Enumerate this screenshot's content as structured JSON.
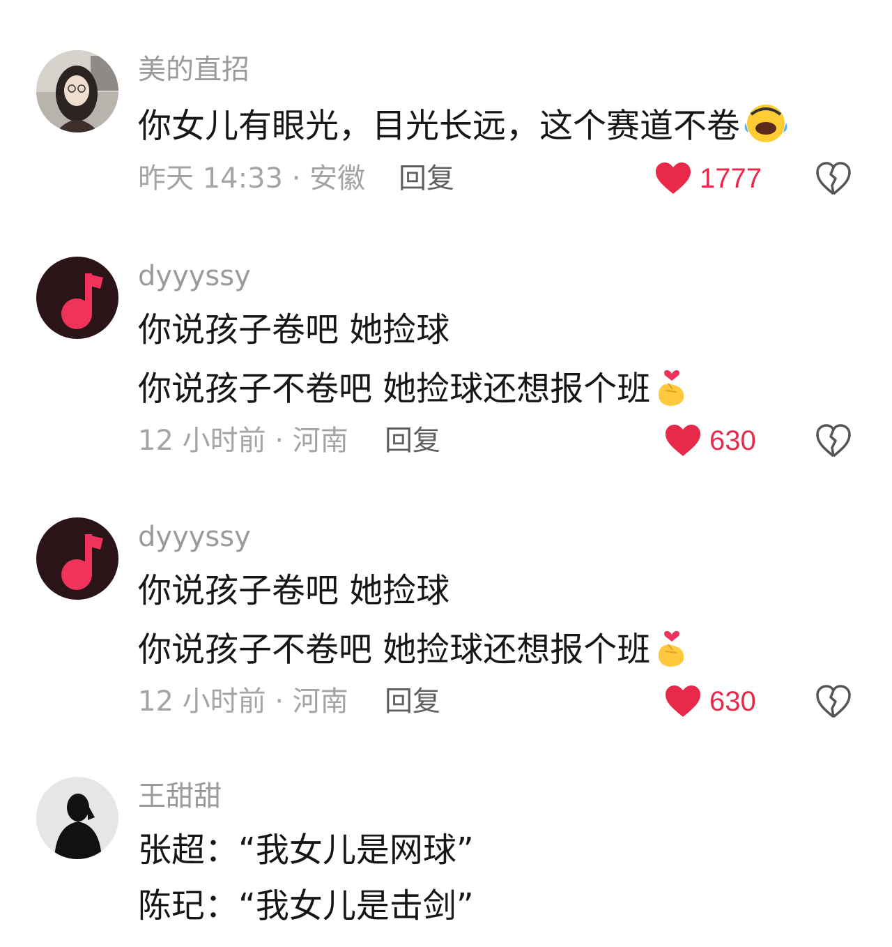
{
  "colors": {
    "like_red": "#e8294a",
    "meta_gray": "#a4a4a4",
    "reply_gray": "#5f5f5f",
    "text": "#161616"
  },
  "comments": [
    {
      "username": "美的直招",
      "avatar": "photo-avatar-girl",
      "lines": [
        "你女儿有眼光，目光长远，这个赛道不卷"
      ],
      "emoji": "laughing-crying-emoji",
      "meta": "昨天 14:33 · 安徽",
      "reply": "回复",
      "likes": "1777"
    },
    {
      "username": "dyyyssy",
      "avatar": "music-note-avatar",
      "lines": [
        "你说孩子卷吧  她捡球",
        "你说孩子不卷吧 她捡球还想报个班"
      ],
      "emoji": "finger-heart-emoji",
      "meta": "12 小时前 · 河南",
      "reply": "回复",
      "likes": "630"
    },
    {
      "username": "dyyyssy",
      "avatar": "music-note-avatar",
      "lines": [
        "你说孩子卷吧  她捡球",
        "你说孩子不卷吧 她捡球还想报个班"
      ],
      "emoji": "finger-heart-emoji",
      "meta": "12 小时前 · 河南",
      "reply": "回复",
      "likes": "630"
    },
    {
      "username": "王甜甜",
      "avatar": "silhouette-avatar",
      "lines": [
        "张超：“我女儿是网球”",
        "陈玘：“我女儿是击剑”"
      ]
    }
  ]
}
